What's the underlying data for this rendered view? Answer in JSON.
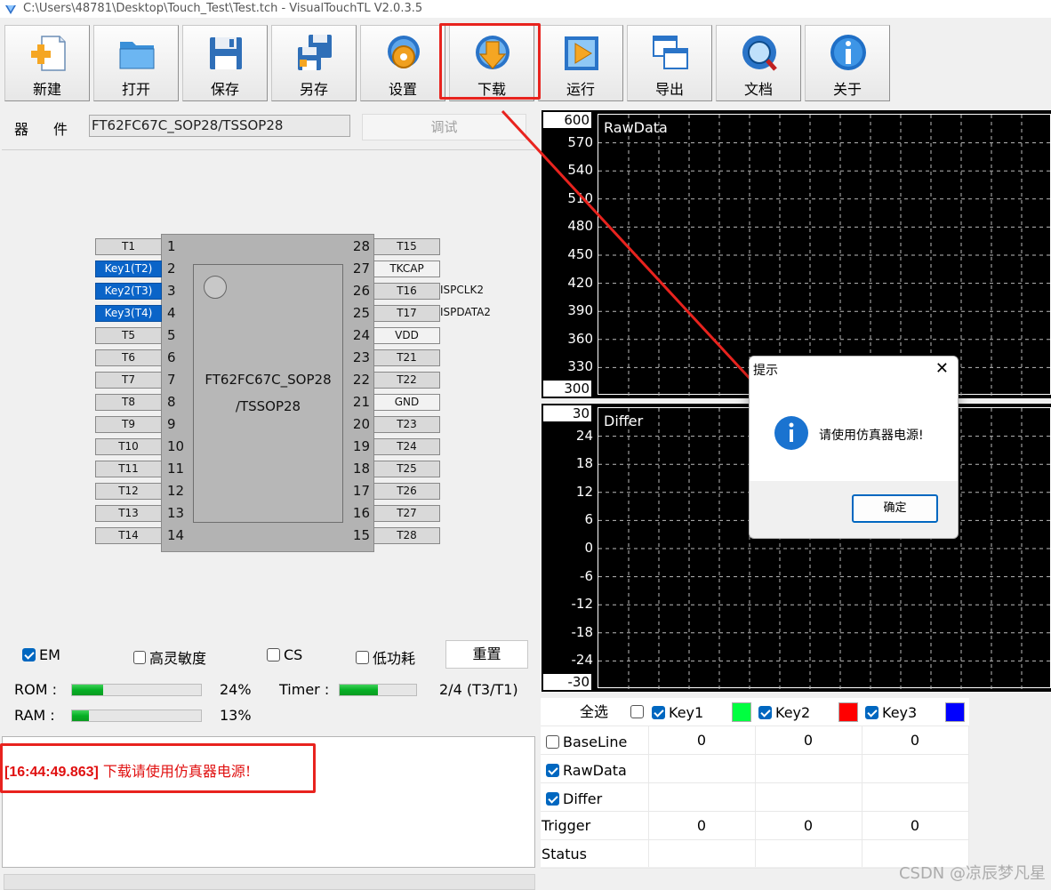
{
  "window": {
    "title": "C:\\Users\\48781\\Desktop\\Touch_Test\\Test.tch - VisualTouchTL V2.0.3.5"
  },
  "toolbar": {
    "buttons": [
      {
        "label": "新建",
        "icon": "new-file-icon"
      },
      {
        "label": "打开",
        "icon": "folder-icon"
      },
      {
        "label": "保存",
        "icon": "save-disk-icon"
      },
      {
        "label": "另存",
        "icon": "save-as-icon"
      },
      {
        "label": "设置",
        "icon": "gear-globe-icon"
      },
      {
        "label": "下载",
        "icon": "download-arrow-icon"
      },
      {
        "label": "运行",
        "icon": "play-icon"
      },
      {
        "label": "导出",
        "icon": "export-windows-icon"
      },
      {
        "label": "文档",
        "icon": "search-globe-icon"
      },
      {
        "label": "关于",
        "icon": "info-icon"
      }
    ]
  },
  "device": {
    "label": "器件",
    "value": "FT62FC67C_SOP28/TSSOP28",
    "debug_label": "调试"
  },
  "chip": {
    "name_line1": "FT62FC67C_SOP28",
    "name_line2": "/TSSOP28",
    "left_pins": [
      {
        "num": "1",
        "label": "T1",
        "selected": false
      },
      {
        "num": "2",
        "label": "Key1(T2)",
        "selected": true
      },
      {
        "num": "3",
        "label": "Key2(T3)",
        "selected": true
      },
      {
        "num": "4",
        "label": "Key3(T4)",
        "selected": true
      },
      {
        "num": "5",
        "label": "T5",
        "selected": false
      },
      {
        "num": "6",
        "label": "T6",
        "selected": false
      },
      {
        "num": "7",
        "label": "T7",
        "selected": false
      },
      {
        "num": "8",
        "label": "T8",
        "selected": false
      },
      {
        "num": "9",
        "label": "T9",
        "selected": false
      },
      {
        "num": "10",
        "label": "T10",
        "selected": false
      },
      {
        "num": "11",
        "label": "T11",
        "selected": false
      },
      {
        "num": "12",
        "label": "T12",
        "selected": false
      },
      {
        "num": "13",
        "label": "T13",
        "selected": false
      },
      {
        "num": "14",
        "label": "T14",
        "selected": false
      }
    ],
    "right_pins": [
      {
        "num": "28",
        "label": "T15",
        "white": false
      },
      {
        "num": "27",
        "label": "TKCAP",
        "white": true
      },
      {
        "num": "26",
        "label": "T16",
        "white": false
      },
      {
        "num": "25",
        "label": "T17",
        "white": false
      },
      {
        "num": "24",
        "label": "VDD",
        "white": true
      },
      {
        "num": "23",
        "label": "T21",
        "white": false
      },
      {
        "num": "22",
        "label": "T22",
        "white": false
      },
      {
        "num": "21",
        "label": "GND",
        "white": true
      },
      {
        "num": "20",
        "label": "T23",
        "white": false
      },
      {
        "num": "19",
        "label": "T24",
        "white": false
      },
      {
        "num": "18",
        "label": "T25",
        "white": false
      },
      {
        "num": "17",
        "label": "T26",
        "white": false
      },
      {
        "num": "16",
        "label": "T27",
        "white": false
      },
      {
        "num": "15",
        "label": "T28",
        "white": false
      }
    ],
    "side_labels": {
      "pin26": "ISPCLK2",
      "pin25": "ISPDATA2"
    }
  },
  "options": {
    "em": {
      "label": "EM",
      "checked": true
    },
    "high_sens": {
      "label": "高灵敏度",
      "checked": false
    },
    "cs": {
      "label": "CS",
      "checked": false
    },
    "low_power": {
      "label": "低功耗",
      "checked": false
    },
    "reset_label": "重置"
  },
  "resources": {
    "rom_label": "ROM :",
    "rom_percent": 24,
    "rom_text": "24%",
    "ram_label": "RAM :",
    "ram_percent": 13,
    "ram_text": "13%",
    "timer_label": "Timer :",
    "timer_fraction": 0.5,
    "timer_text": "2/4 (T3/T1)"
  },
  "log": {
    "timestamp": "[16:44:49.863]",
    "message": " 下载请使用仿真器电源!"
  },
  "charts": {
    "rawdata": {
      "title": "RawData",
      "ymax": "600",
      "ymin": "300",
      "ticks": [
        "570",
        "540",
        "510",
        "480",
        "450",
        "420",
        "390",
        "360",
        "330"
      ]
    },
    "differ": {
      "title": "Differ",
      "ymax": "30",
      "ymin": "-30",
      "ticks": [
        "24",
        "18",
        "12",
        "6",
        "0",
        "-6",
        "-12",
        "-18",
        "-24"
      ]
    }
  },
  "table": {
    "select_all": "全选",
    "keys": [
      {
        "label": "Key1",
        "checked": true,
        "color": "#00ff40"
      },
      {
        "label": "Key2",
        "checked": true,
        "color": "#ff0000"
      },
      {
        "label": "Key3",
        "checked": true,
        "color": "#0000ff"
      }
    ],
    "rows": [
      {
        "label": "BaseLine",
        "checkbox": true,
        "checked": false,
        "values": [
          "0",
          "0",
          "0"
        ]
      },
      {
        "label": "RawData",
        "checkbox": true,
        "checked": true,
        "values": [
          "",
          "",
          ""
        ]
      },
      {
        "label": "Differ",
        "checkbox": true,
        "checked": true,
        "values": [
          "",
          "",
          ""
        ]
      },
      {
        "label": "Trigger",
        "checkbox": false,
        "checked": false,
        "values": [
          "0",
          "0",
          "0"
        ]
      },
      {
        "label": "Status",
        "checkbox": false,
        "checked": false,
        "values": [
          "",
          "",
          ""
        ]
      }
    ]
  },
  "dialog": {
    "title": "提示",
    "close": "✕",
    "message": "请使用仿真器电源!",
    "ok_label": "确定"
  },
  "watermark": "CSDN @凉辰梦凡星"
}
